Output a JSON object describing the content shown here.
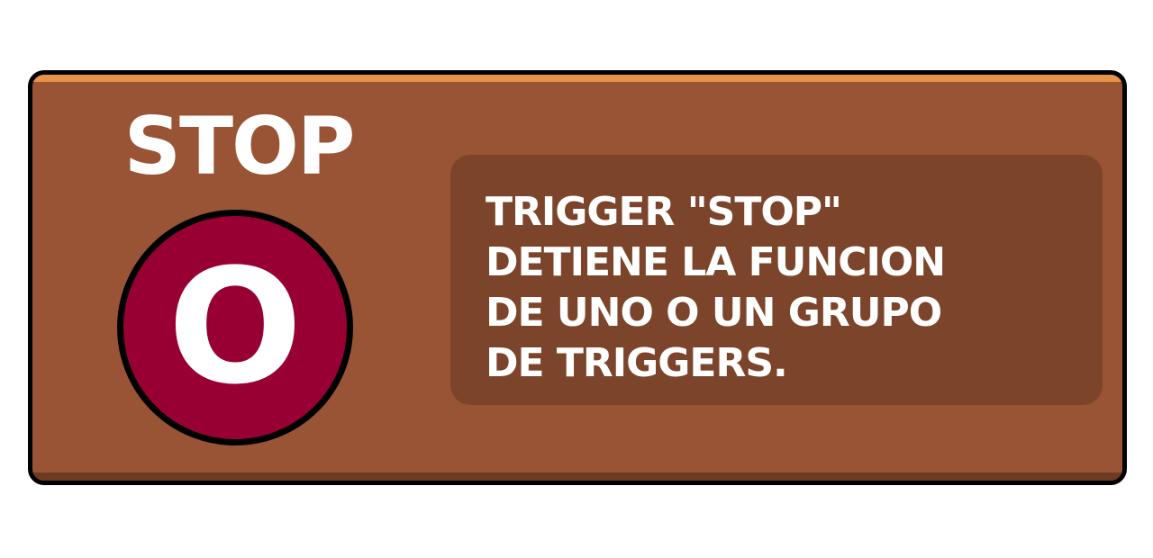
{
  "card": {
    "title": "STOP",
    "badge_letter": "O",
    "description_lines": [
      "TRIGGER \"STOP\"",
      "DETIENE LA FUNCION",
      "DE UNO O UN GRUPO",
      "DE TRIGGERS."
    ]
  },
  "colors": {
    "panel": "#985435",
    "panel_border": "#000000",
    "panel_highlight": "#e8934a",
    "info_box": "#7c452b",
    "badge": "#980033",
    "text": "#ffffff"
  }
}
